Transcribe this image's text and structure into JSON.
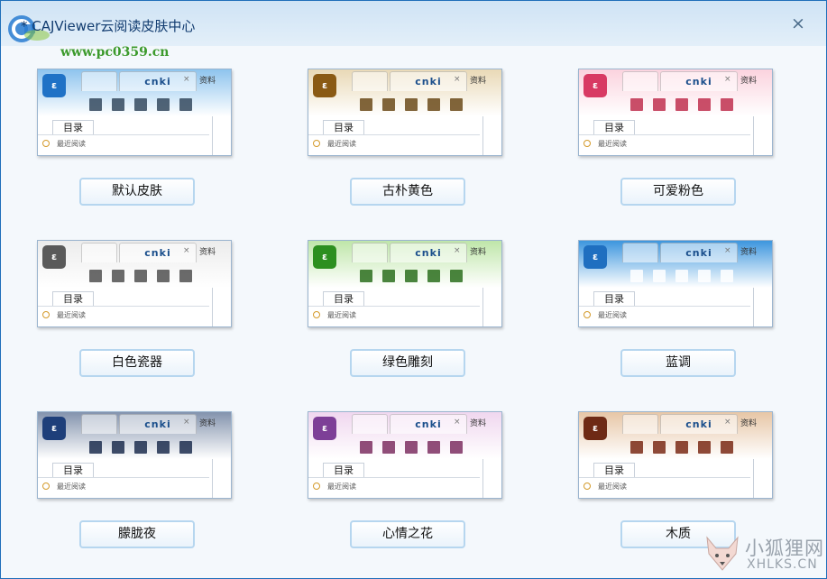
{
  "window": {
    "title": "* CAJViewer云阅读皮肤中心",
    "close_symbol": "×",
    "watermark_url": "www.pc0359.cn"
  },
  "preview": {
    "tab_brand": "cnki",
    "tab_close": "×",
    "tab_partial": "资料",
    "toc_tab": "目录",
    "recent": "最近阅读"
  },
  "skins": [
    {
      "label": "默认皮肤",
      "top_color": "#8ec4ee",
      "logo_color": "#1f72c6",
      "icon_color": "#34495e"
    },
    {
      "label": "古朴黄色",
      "top_color": "#e9d9b6",
      "logo_color": "#8a5a14",
      "icon_color": "#6b4a1a"
    },
    {
      "label": "可爱粉色",
      "top_color": "#fbd3de",
      "logo_color": "#d83a63",
      "icon_color": "#c0304f"
    },
    {
      "label": "白色瓷器",
      "top_color": "#ececec",
      "logo_color": "#5a5a5a",
      "icon_color": "#505050"
    },
    {
      "label": "绿色雕刻",
      "top_color": "#bfe6a9",
      "logo_color": "#2c8f1f",
      "icon_color": "#2c6e1d"
    },
    {
      "label": "蓝调",
      "top_color": "#3d96de",
      "logo_color": "#1f6fc0",
      "icon_color": "#ffffff"
    },
    {
      "label": "朦胧夜",
      "top_color": "#8393ad",
      "logo_color": "#1e3f7a",
      "icon_color": "#1d2e4f"
    },
    {
      "label": "心情之花",
      "top_color": "#f0d7ef",
      "logo_color": "#7d3f97",
      "icon_color": "#7d2f62"
    },
    {
      "label": "木质",
      "top_color": "#e7c6a6",
      "logo_color": "#6e2a15",
      "icon_color": "#7a2a16"
    }
  ],
  "site_logo": {
    "name": "小狐狸网",
    "domain": "XHLKS.CN"
  }
}
